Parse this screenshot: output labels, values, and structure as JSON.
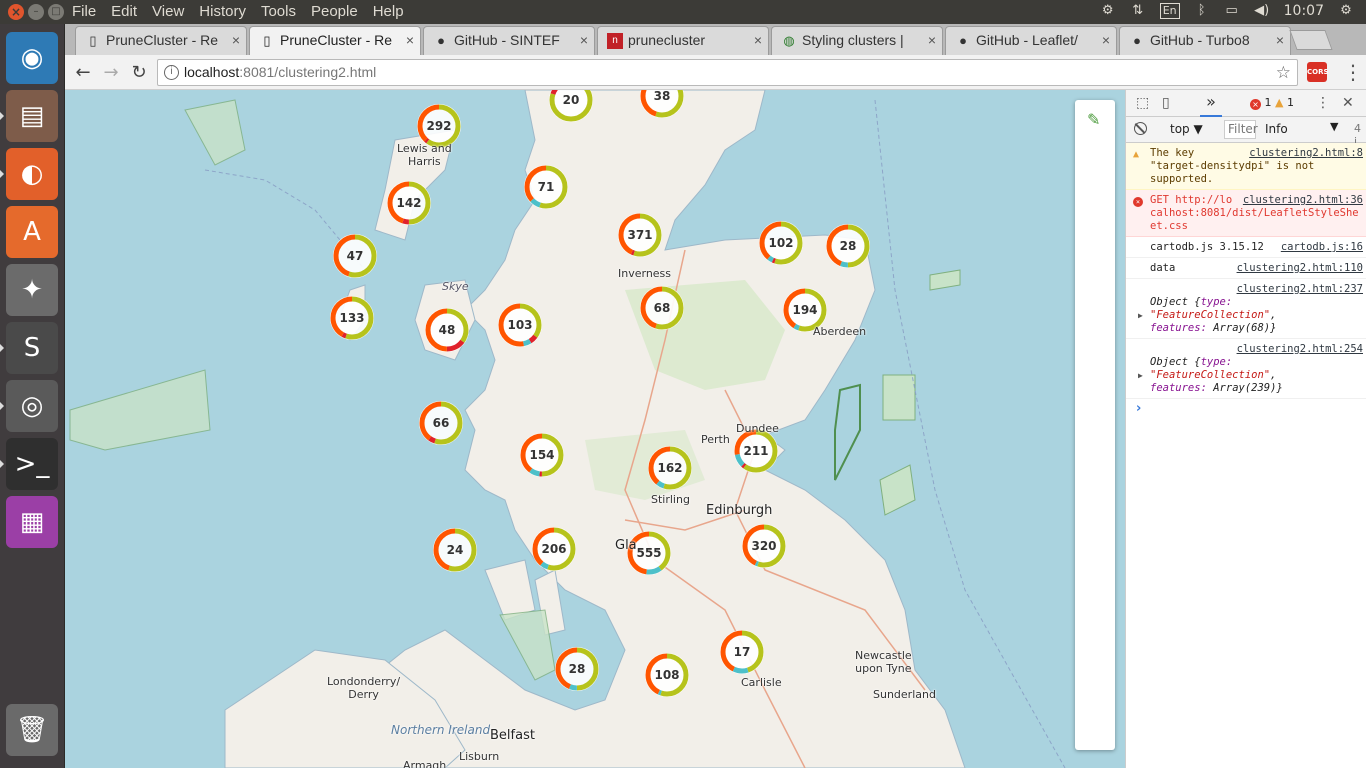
{
  "os": {
    "menu": [
      "File",
      "Edit",
      "View",
      "History",
      "Tools",
      "People",
      "Help"
    ],
    "tray": {
      "lang": "En",
      "clock": "10:07"
    }
  },
  "tabs": [
    {
      "title": "PruneCluster - Re",
      "icon": "page-icon"
    },
    {
      "title": "PruneCluster - Re",
      "icon": "page-icon",
      "active": true
    },
    {
      "title": "GitHub - SINTEF",
      "icon": "github-icon"
    },
    {
      "title": "prunecluster",
      "icon": "npm-icon"
    },
    {
      "title": "Styling clusters |",
      "icon": "globe-icon"
    },
    {
      "title": "GitHub - Leaflet/",
      "icon": "github-icon"
    },
    {
      "title": "GitHub - Turbo8",
      "icon": "github-icon"
    }
  ],
  "address": {
    "host": "localhost",
    "rest": ":8081/clustering2.html"
  },
  "extension_label": "CORS",
  "map": {
    "clusters": [
      {
        "count": "20",
        "green": 0.8,
        "red": 0.1,
        "cyan": 0.05
      },
      {
        "count": "38",
        "green": 0.55,
        "red": 0.0,
        "cyan": 0.0
      },
      {
        "count": "292",
        "green": 0.6,
        "red": 0.02,
        "cyan": 0.0
      },
      {
        "count": "71",
        "green": 0.55,
        "red": 0.0,
        "cyan": 0.08
      },
      {
        "count": "142",
        "green": 0.5,
        "red": 0.05,
        "cyan": 0.0
      },
      {
        "count": "371",
        "green": 0.55,
        "red": 0.02,
        "cyan": 0.0
      },
      {
        "count": "102",
        "green": 0.55,
        "red": 0.02,
        "cyan": 0.04
      },
      {
        "count": "28",
        "green": 0.5,
        "red": 0.0,
        "cyan": 0.06
      },
      {
        "count": "47",
        "green": 0.55,
        "red": 0.0,
        "cyan": 0.0
      },
      {
        "count": "68",
        "green": 0.55,
        "red": 0.0,
        "cyan": 0.0
      },
      {
        "count": "194",
        "green": 0.55,
        "red": 0.0,
        "cyan": 0.04
      },
      {
        "count": "133",
        "green": 0.55,
        "red": 0.03,
        "cyan": 0.0
      },
      {
        "count": "48",
        "green": 0.35,
        "red": 0.15,
        "cyan": 0.0
      },
      {
        "count": "103",
        "green": 0.35,
        "red": 0.06,
        "cyan": 0.06
      },
      {
        "count": "66",
        "green": 0.55,
        "red": 0.05,
        "cyan": 0.0
      },
      {
        "count": "154",
        "green": 0.5,
        "red": 0.02,
        "cyan": 0.08
      },
      {
        "count": "162",
        "green": 0.55,
        "red": 0.0,
        "cyan": 0.06
      },
      {
        "count": "211",
        "green": 0.6,
        "red": 0.02,
        "cyan": 0.1
      },
      {
        "count": "24",
        "green": 0.55,
        "red": 0.0,
        "cyan": 0.0
      },
      {
        "count": "206",
        "green": 0.55,
        "red": 0.0,
        "cyan": 0.06
      },
      {
        "count": "555",
        "green": 0.4,
        "red": 0.0,
        "cyan": 0.12
      },
      {
        "count": "320",
        "green": 0.55,
        "red": 0.0,
        "cyan": 0.02
      },
      {
        "count": "28",
        "green": 0.5,
        "red": 0.0,
        "cyan": 0.06
      },
      {
        "count": "108",
        "green": 0.55,
        "red": 0.0,
        "cyan": 0.02
      },
      {
        "count": "17",
        "green": 0.45,
        "red": 0.0,
        "cyan": 0.12
      }
    ],
    "places": {
      "lewis": "Lewis and\nHarris",
      "skye": "Skye",
      "inverness": "Inverness",
      "aberdeen": "Aberdeen",
      "dundee": "Dundee",
      "perth": "Perth",
      "stirling": "Stirling",
      "edinburgh": "Edinburgh",
      "glasgow": "Gla",
      "newcastle": "Newcastle\nupon Tyne",
      "sunderland": "Sunderland",
      "carlisle": "Carlisle",
      "londonderry": "Londonderry/\nDerry",
      "northern_ireland": "Northern Ireland",
      "belfast": "Belfast",
      "lisburn": "Lisburn",
      "armagh": "Armagh"
    }
  },
  "devtools": {
    "error_count": "1",
    "warn_count": "1",
    "context": "top",
    "filter_placeholder": "Filter",
    "level": "Info",
    "truncated": "4 i",
    "messages": [
      {
        "type": "warn",
        "src": "clustering2.html:8",
        "text": "The key \"target-densitydpi\" is not supported."
      },
      {
        "type": "error",
        "src": "clustering2.html:36",
        "text": "GET http://localhost:8081/dist/LeafletStyleSheet.css"
      },
      {
        "type": "log",
        "src": "cartodb.js:16",
        "text": "cartodb.js 3.15.12"
      },
      {
        "type": "log",
        "src": "clustering2.html:110",
        "text": "data"
      },
      {
        "type": "log",
        "src": "clustering2.html:237",
        "obj_type": "\"FeatureCollection\"",
        "obj_features": "Array(68)"
      },
      {
        "type": "log",
        "src": "clustering2.html:254",
        "obj_type": "\"FeatureCollection\"",
        "obj_features": "Array(239)"
      }
    ],
    "obj_prefix": "Object {",
    "key_type": "type:",
    "key_features": "features:",
    "obj_suffix": "}"
  },
  "colors": {
    "sea": "#aad3df",
    "land": "#f2efe9",
    "ring_orange": "#ff5500",
    "ring_green": "#b6c31c",
    "ring_red": "#e0222b",
    "ring_cyan": "#4dc0c9"
  }
}
